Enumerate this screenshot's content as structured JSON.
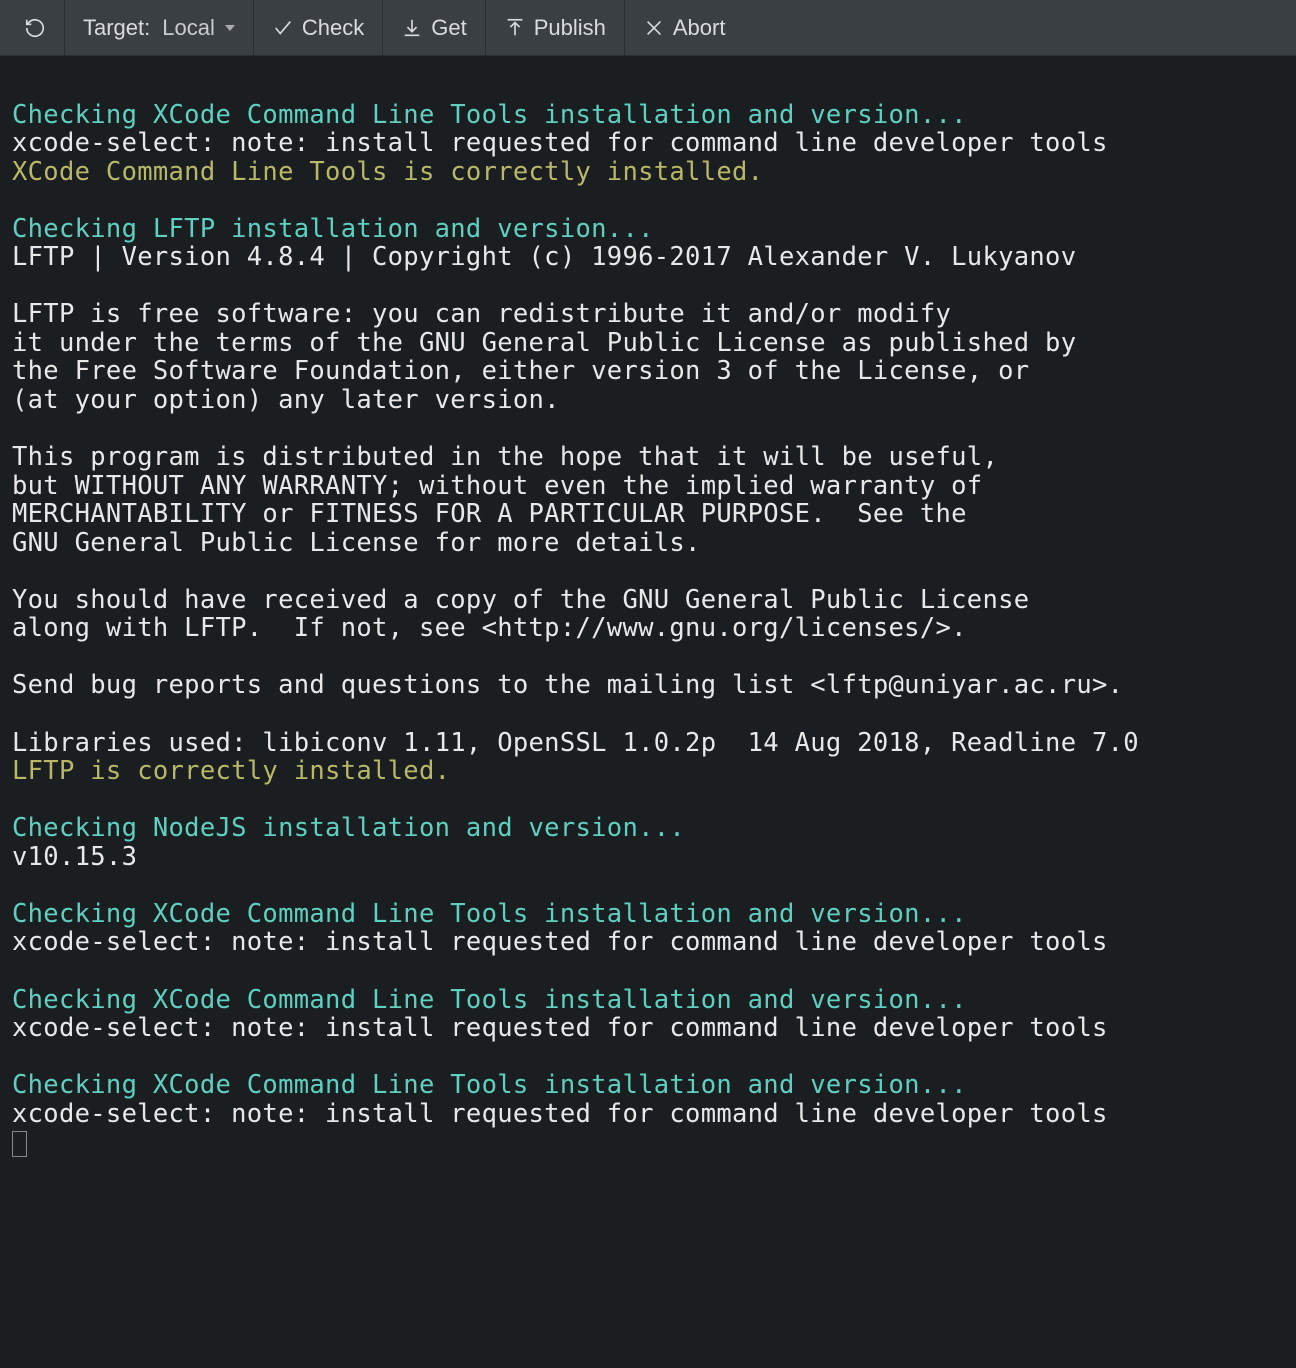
{
  "toolbar": {
    "target_label": "Target:",
    "target_value": "Local",
    "check_label": "Check",
    "get_label": "Get",
    "publish_label": "Publish",
    "abort_label": "Abort"
  },
  "terminal": {
    "lines": [
      {
        "text": "",
        "cls": "line-white"
      },
      {
        "text": "Checking XCode Command Line Tools installation and version...",
        "cls": "line-cyan"
      },
      {
        "text": "xcode-select: note: install requested for command line developer tools",
        "cls": "line-white"
      },
      {
        "text": "XCode Command Line Tools is correctly installed.",
        "cls": "line-yellow"
      },
      {
        "text": "",
        "cls": "line-white"
      },
      {
        "text": "Checking LFTP installation and version...",
        "cls": "line-cyan"
      },
      {
        "text": "LFTP | Version 4.8.4 | Copyright (c) 1996-2017 Alexander V. Lukyanov",
        "cls": "line-white"
      },
      {
        "text": "",
        "cls": "line-white"
      },
      {
        "text": "LFTP is free software: you can redistribute it and/or modify",
        "cls": "line-white"
      },
      {
        "text": "it under the terms of the GNU General Public License as published by",
        "cls": "line-white"
      },
      {
        "text": "the Free Software Foundation, either version 3 of the License, or",
        "cls": "line-white"
      },
      {
        "text": "(at your option) any later version.",
        "cls": "line-white"
      },
      {
        "text": "",
        "cls": "line-white"
      },
      {
        "text": "This program is distributed in the hope that it will be useful,",
        "cls": "line-white"
      },
      {
        "text": "but WITHOUT ANY WARRANTY; without even the implied warranty of",
        "cls": "line-white"
      },
      {
        "text": "MERCHANTABILITY or FITNESS FOR A PARTICULAR PURPOSE.  See the",
        "cls": "line-white"
      },
      {
        "text": "GNU General Public License for more details.",
        "cls": "line-white"
      },
      {
        "text": "",
        "cls": "line-white"
      },
      {
        "text": "You should have received a copy of the GNU General Public License",
        "cls": "line-white"
      },
      {
        "text": "along with LFTP.  If not, see <http://www.gnu.org/licenses/>.",
        "cls": "line-white"
      },
      {
        "text": "",
        "cls": "line-white"
      },
      {
        "text": "Send bug reports and questions to the mailing list <lftp@uniyar.ac.ru>.",
        "cls": "line-white"
      },
      {
        "text": "",
        "cls": "line-white"
      },
      {
        "text": "Libraries used: libiconv 1.11, OpenSSL 1.0.2p  14 Aug 2018, Readline 7.0",
        "cls": "line-white"
      },
      {
        "text": "LFTP is correctly installed.",
        "cls": "line-yellow"
      },
      {
        "text": "",
        "cls": "line-white"
      },
      {
        "text": "Checking NodeJS installation and version...",
        "cls": "line-cyan"
      },
      {
        "text": "v10.15.3",
        "cls": "line-white"
      },
      {
        "text": "",
        "cls": "line-white"
      },
      {
        "text": "Checking XCode Command Line Tools installation and version...",
        "cls": "line-cyan"
      },
      {
        "text": "xcode-select: note: install requested for command line developer tools",
        "cls": "line-white"
      },
      {
        "text": "",
        "cls": "line-white"
      },
      {
        "text": "Checking XCode Command Line Tools installation and version...",
        "cls": "line-cyan"
      },
      {
        "text": "xcode-select: note: install requested for command line developer tools",
        "cls": "line-white"
      },
      {
        "text": "",
        "cls": "line-white"
      },
      {
        "text": "Checking XCode Command Line Tools installation and version...",
        "cls": "line-cyan"
      },
      {
        "text": "xcode-select: note: install requested for command line developer tools",
        "cls": "line-white"
      }
    ]
  }
}
